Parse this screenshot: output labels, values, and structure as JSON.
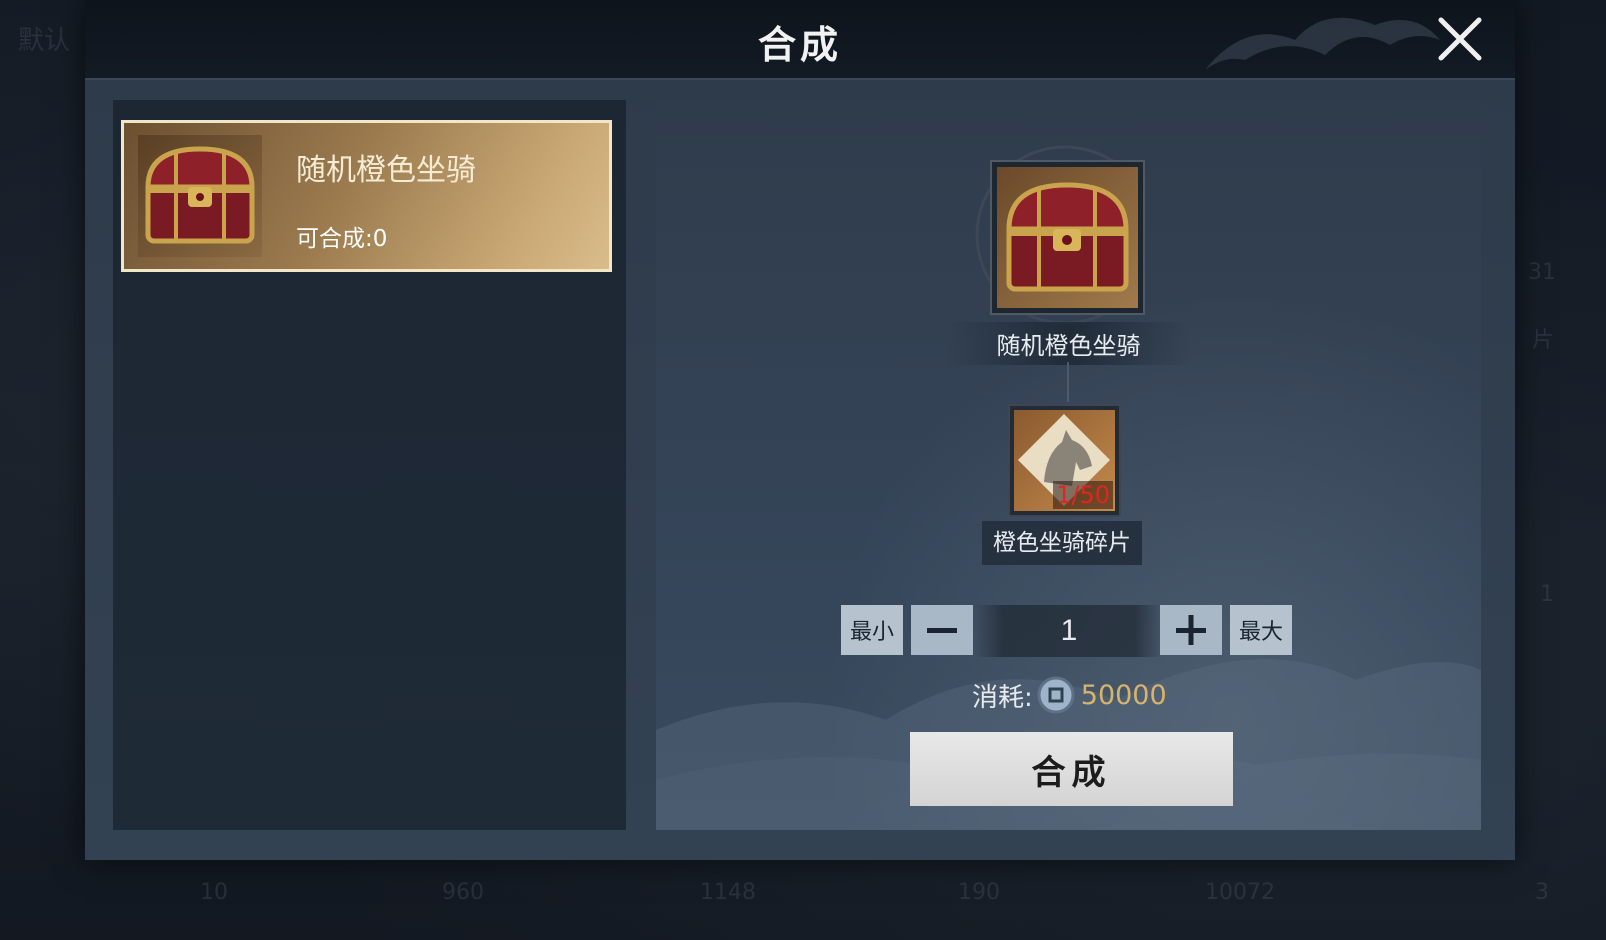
{
  "background": {
    "corner_label": "默认",
    "fade_labels": [
      "31",
      "片",
      "1",
      "10",
      "960",
      "1148",
      "190",
      "10072",
      "3"
    ]
  },
  "dialog": {
    "title": "合成",
    "close_icon": "close-icon"
  },
  "recipe_list": {
    "items": [
      {
        "name": "随机橙色坐骑",
        "craftable_label": "可合成:0",
        "icon": "treasure-chest-icon",
        "selected": true
      }
    ]
  },
  "detail": {
    "result": {
      "name": "随机橙色坐骑",
      "icon": "treasure-chest-icon"
    },
    "material": {
      "name": "橙色坐骑碎片",
      "count": "1/50",
      "icon": "horse-fragment-icon"
    },
    "quantity": {
      "min_label": "最小",
      "max_label": "最大",
      "value": "1"
    },
    "cost": {
      "label": "消耗:",
      "value": "50000",
      "icon": "coin-icon"
    },
    "craft_button": "合成"
  },
  "colors": {
    "accent_gold": "#d7b46b",
    "material_count_red": "#e1261c",
    "selected_border": "#f1e6c8"
  }
}
